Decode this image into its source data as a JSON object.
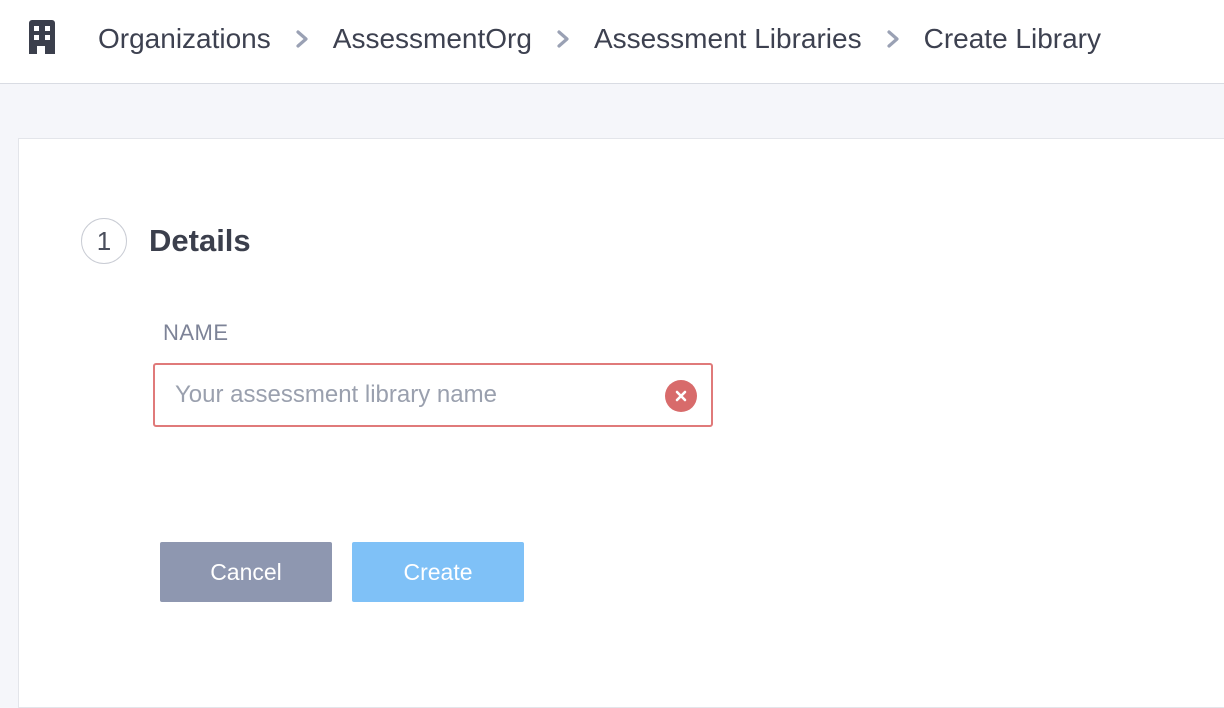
{
  "header": {
    "breadcrumb": [
      {
        "label": "Organizations"
      },
      {
        "label": "AssessmentOrg"
      },
      {
        "label": "Assessment Libraries"
      },
      {
        "label": "Create Library"
      }
    ]
  },
  "form": {
    "step_number": "1",
    "step_title": "Details",
    "name_label": "NAME",
    "name_value": "",
    "name_placeholder": "Your assessment library name",
    "name_state": "error"
  },
  "actions": {
    "cancel_label": "Cancel",
    "create_label": "Create",
    "create_enabled": false
  },
  "icons": {
    "org": "building-icon",
    "separator": "chevron-right-icon",
    "clear": "close-circle-icon"
  },
  "colors": {
    "error": "#d86b6b",
    "cancel_button": "#8e97b0",
    "create_button_disabled": "#7fc1f7",
    "text": "#3d4150"
  }
}
